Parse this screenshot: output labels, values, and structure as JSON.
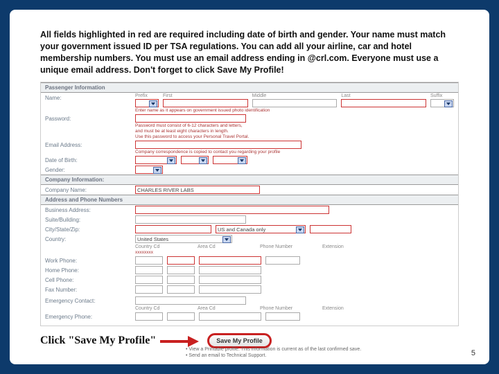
{
  "pageNumber": "5",
  "instruction": "All fields highlighted in red are required including date of birth and gender. Your name must match your government issued ID per TSA regulations. You can add all your airline, car and hotel membership numbers. You must use an email address ending in @crl.com. Everyone must use a unique email address. Don't forget to click Save My Profile!",
  "sections": {
    "passenger": "Passenger Information",
    "company": "Company Information:",
    "address": "Address and Phone Numbers"
  },
  "nameCols": {
    "prefix": "Prefix",
    "first": "First",
    "middle": "Middle",
    "last": "Last",
    "suffix": "Suffix"
  },
  "labels": {
    "name": "Name:",
    "password": "Password:",
    "email": "Email Address:",
    "dob": "Date of Birth:",
    "gender": "Gender:",
    "companyName": "Company Name:",
    "busAddr": "Business Address:",
    "suite": "Suite/Building:",
    "csz": "City/State/Zip:",
    "country": "Country:",
    "workPhone": "Work Phone:",
    "homePhone": "Home Phone:",
    "cellPhone": "Cell Phone:",
    "fax": "Fax Number:",
    "emergency": "Emergency Contact:",
    "emergencyPhone": "Emergency Phone:"
  },
  "helpers": {
    "nameHelp": "Enter name as it appears on government issued photo identification",
    "pw1": "Password must consist of 6-12 characters and letters,",
    "pw2": "and must be at least eight characters in length.",
    "pw3": "Use this password to access your Personal Travel Portal.",
    "emailHelp": "Company correspondence is copied to contact you regarding your profile"
  },
  "values": {
    "companyName": "CHARLES RIVER LABS",
    "cityState": "US and Canada only",
    "countryVal": "United States",
    "xReq": "xxxxxxxx"
  },
  "phoneCols": {
    "countryCd": "Country Cd",
    "areaCd": "Area Cd",
    "phoneNum": "Phone Number",
    "ext": "Extension"
  },
  "click": "Click \"Save My Profile\"",
  "saveBtn": "Save My Profile",
  "foot1": "View a Printable profile. This information is current as of the last confirmed save.",
  "foot2": "Send an email to Technical Support."
}
